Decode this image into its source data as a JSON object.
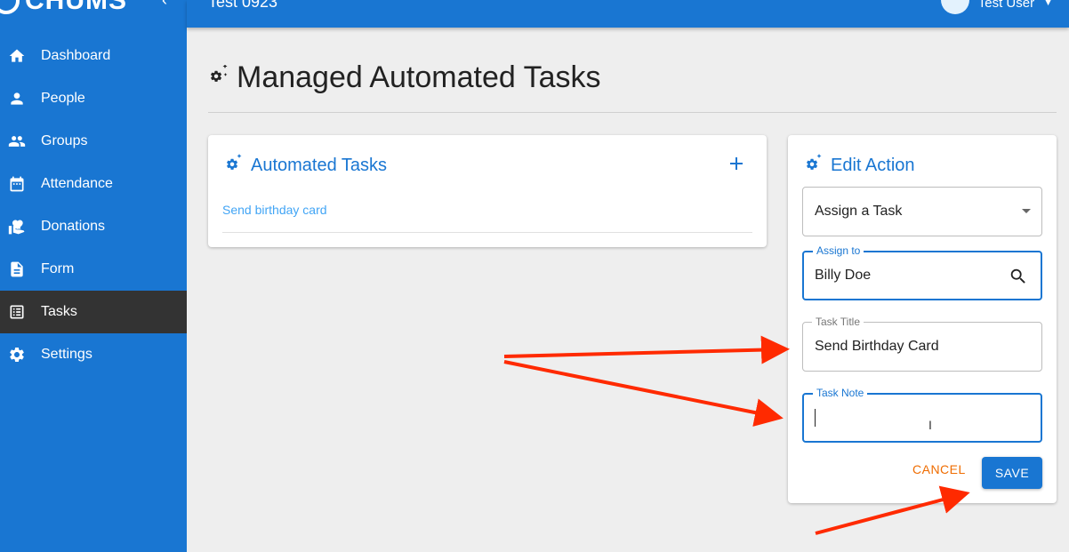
{
  "brand": {
    "name": "CHUMS"
  },
  "topbar": {
    "title": "Test 0923",
    "user_name": "Test User"
  },
  "sidebar": {
    "items": [
      {
        "label": "Dashboard",
        "icon": "home-icon"
      },
      {
        "label": "People",
        "icon": "person-icon"
      },
      {
        "label": "Groups",
        "icon": "groups-icon"
      },
      {
        "label": "Attendance",
        "icon": "calendar-icon"
      },
      {
        "label": "Donations",
        "icon": "donation-icon"
      },
      {
        "label": "Form",
        "icon": "form-icon"
      },
      {
        "label": "Tasks",
        "icon": "list-icon",
        "active": true
      },
      {
        "label": "Settings",
        "icon": "gear-icon"
      }
    ]
  },
  "page": {
    "title": "Managed Automated Tasks"
  },
  "tasks_card": {
    "title": "Automated Tasks",
    "items": [
      {
        "label": "Send birthday card"
      }
    ]
  },
  "edit_card": {
    "title": "Edit Action",
    "action_type": {
      "value": "Assign a Task"
    },
    "assign_to": {
      "label": "Assign to",
      "value": "Billy Doe"
    },
    "task_title": {
      "label": "Task Title",
      "value": "Send Birthday Card"
    },
    "task_note": {
      "label": "Task Note",
      "value": ""
    },
    "cancel_label": "CANCEL",
    "save_label": "SAVE"
  },
  "colors": {
    "primary": "#1976d2",
    "active_nav": "#333333",
    "cancel": "#ef6c00",
    "link": "#42a5f5",
    "annotation": "#ff2a00"
  }
}
